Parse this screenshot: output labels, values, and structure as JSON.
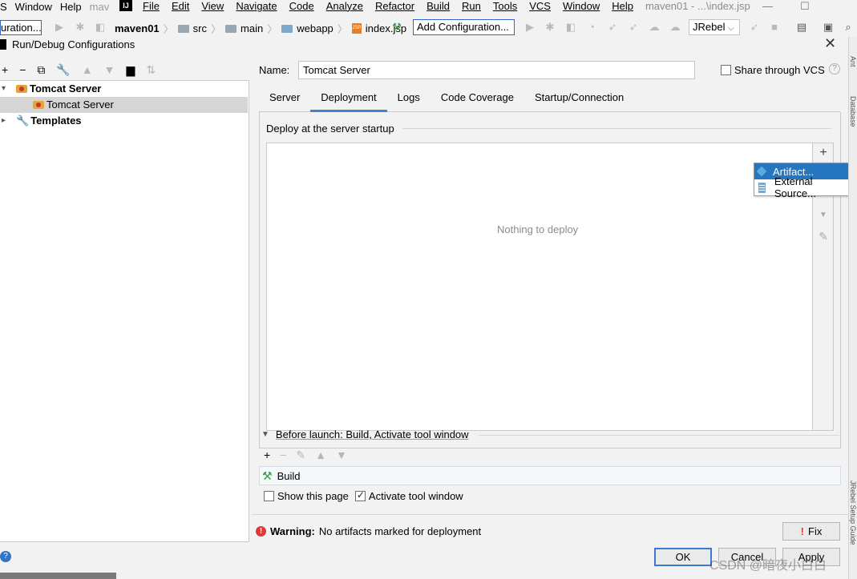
{
  "ide": {
    "left_menu": [
      "S",
      "Window",
      "Help",
      "mav"
    ],
    "main_menu": [
      "File",
      "Edit",
      "View",
      "Navigate",
      "Code",
      "Analyze",
      "Refactor",
      "Build",
      "Run",
      "Tools",
      "VCS",
      "Window",
      "Help"
    ],
    "window_title": "maven01 - ...\\index.jsp",
    "logo_text": "IJ",
    "config_left": "uration...",
    "breadcrumbs": [
      "maven01",
      "src",
      "main",
      "webapp",
      "index.jsp"
    ],
    "add_config_label": "Add Configuration...",
    "jrebel_label": "JRebel",
    "right_stripe": [
      "Ant",
      "Database",
      "JRebel Setup Guide"
    ]
  },
  "dialog": {
    "title": "Run/Debug Configurations",
    "tree": {
      "group_label": "Tomcat Server",
      "child_label": "Tomcat Server",
      "templates_label": "Templates"
    },
    "name_label": "Name:",
    "name_value": "Tomcat Server",
    "share_label": "Share through VCS",
    "tabs": [
      "Server",
      "Deployment",
      "Logs",
      "Code Coverage",
      "Startup/Connection"
    ],
    "active_tab": "Deployment",
    "deploy_title": "Deploy at the server startup",
    "nothing_to_deploy": "Nothing to deploy",
    "popup_items": [
      "Artifact...",
      "External Source..."
    ],
    "before_launch": "Before launch: Build, Activate tool window",
    "build_item": "Build",
    "show_page_label": "Show this page",
    "activate_label": "Activate tool window",
    "warning_bold": "Warning:",
    "warning_text": "No artifacts marked for deployment",
    "fix_label": "Fix",
    "ok_label": "OK",
    "cancel_label": "Cancel",
    "apply_label": "Apply",
    "watermark": "CSDN @暗夜小白白"
  },
  "colors": {
    "accent": "#4083c9",
    "selection": "#2675bf",
    "warning": "#d93b3b",
    "build_green": "#2e9b3c"
  }
}
